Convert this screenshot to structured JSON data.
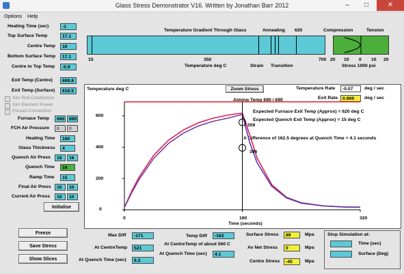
{
  "window": {
    "title": "Glass Stress Demonstrator V16. Written by Jonathan Barr 2012",
    "btn_min": "–",
    "btn_max": "□",
    "btn_close": "✕"
  },
  "menu": {
    "options": "Options",
    "help": "Help"
  },
  "left_top": {
    "heating_time_label": "Heating Time (sec)",
    "heating_time_value": "-1",
    "top_surface_label": "Top Surface Temp",
    "top_surface_value": "17.1",
    "centre_label": "Centre Temp",
    "centre_value": "16",
    "bottom_surface_label": "Bottom Surface Temp",
    "bottom_surface_value": "17.1",
    "centre_to_top_label": "Centre to Top Temp",
    "centre_to_top_value": "-0.9",
    "exit_centre_label": "Exit Temp  (Centre)",
    "exit_centre_value": "608.8",
    "exit_surface_label": "Exit Temp (Surface)",
    "exit_surface_value": "618.5"
  },
  "checkboxes": {
    "roll": "Sim Roll Conduction",
    "element": "Sim Element Power",
    "convection": "Forced Convection"
  },
  "params": {
    "furnace_label": "Furnace Temp",
    "furnace_a": "690",
    "furnace_b": "690",
    "fch_label": "FCH Air Pressure",
    "fch_a": "0",
    "fch_b": "0",
    "heating_label": "Heating Time",
    "heating_value": "160",
    "thickness_label": "Glass Thickness",
    "thickness_value": "4",
    "quench_press_label": "Quench Air Press",
    "quench_press_a": "16",
    "quench_press_b": "16",
    "quench_time_label": "Quench Time",
    "quench_time_value": "16",
    "ramp_label": "Ramp Time",
    "ramp_value": "15",
    "final_label": "Final Air Press",
    "final_a": "10",
    "final_b": "10",
    "current_label": "Current Air Press",
    "current_a": "10",
    "current_b": "10",
    "initialise": "Initialise"
  },
  "buttons": {
    "freeze": "Freeze",
    "save": "Save Stress",
    "slices": "Show Slices"
  },
  "gradient": {
    "heading": "Temperature Gradient Through Glass",
    "annealing": "Annealing",
    "t620": "620",
    "compression": "Compression",
    "tension": "Tension",
    "x15": "15",
    "x350": "350",
    "x700": "700",
    "axis_label": "Temperature deg C",
    "strain": "Strain",
    "transition": "Transition",
    "s20a": "20",
    "s10a": "10",
    "s0": "0",
    "s10b": "10",
    "s20b": "20",
    "stress_label": "Stress 1000 psi"
  },
  "chart_panel": {
    "temp_label": "Temperature deg C",
    "zoom_button": "Zoom Stress",
    "temp_rate_label": "Temperature Rate",
    "temp_rate_value": "-0.07",
    "temp_rate_unit": "deg / sec",
    "aiming": "Aiming Temp  690 / 690",
    "exit_rate_label": "Exit Rate",
    "exit_rate_value": "0.969",
    "exit_rate_unit": "deg / sec",
    "expected_furnace": "Expected Furnace Exit Temp (Approx) =  620  deg C",
    "expected_quench": "Expected Quench Exit Temp (Approx) =  15  deg C",
    "difference": "A Difference of 162.5 degrees at Quench Time = 4.1 seconds",
    "y600": "600",
    "y400": "400",
    "y200": "200",
    "y0": "0",
    "x0": "0",
    "x160": "160",
    "x320": "320",
    "x_label": "Time (seconds)",
    "marker_559": "559",
    "marker_396": "396"
  },
  "chart_data": {
    "type": "line",
    "xlabel": "Time (seconds)",
    "ylabel": "Temperature deg C",
    "xlim": [
      0,
      320
    ],
    "ylim": [
      0,
      690
    ],
    "grid": false,
    "series": [
      {
        "x": [
          0,
          320
        ],
        "y": [
          690,
          690
        ],
        "color": "#e02020"
      },
      {
        "x": [
          0,
          10,
          20,
          40,
          60,
          80,
          100,
          120,
          140,
          160
        ],
        "y": [
          15,
          120,
          210,
          350,
          445,
          510,
          555,
          585,
          605,
          618
        ],
        "color": "#d42050"
      },
      {
        "x": [
          0,
          10,
          20,
          40,
          60,
          80,
          100,
          120,
          140,
          160
        ],
        "y": [
          15,
          110,
          195,
          330,
          425,
          490,
          535,
          565,
          585,
          609
        ],
        "color": "#7a3aa0"
      },
      {
        "x": [
          160,
          170,
          180,
          200,
          220,
          240,
          270,
          300,
          320
        ],
        "y": [
          618,
          480,
          330,
          160,
          80,
          45,
          25,
          18,
          17
        ],
        "color": "#d42050"
      },
      {
        "x": [
          160,
          170,
          180,
          200,
          220,
          240,
          270,
          300,
          320
        ],
        "y": [
          609,
          430,
          300,
          150,
          75,
          42,
          24,
          17,
          16
        ],
        "color": "#5a3ab0"
      }
    ],
    "annotations": [
      {
        "x": 160,
        "y": 559,
        "label": "559"
      },
      {
        "x": 160,
        "y": 396,
        "label": "396"
      }
    ]
  },
  "bottom": {
    "max_diff_label": "Max Diff",
    "max_diff_value": "-171",
    "at_centre_label": "At CentreTemp",
    "at_centre_value": "521",
    "at_quench_label": "At Quench Time (sec)",
    "at_quench_value": "6.2",
    "temp_diff_label": "Temp Diff",
    "temp_diff_value": "-162",
    "about_label": "At CentreTemp of about 560 C",
    "at_quench2_label": "At Quench Time (sec)",
    "at_quench2_value": "4.1",
    "surface_label": "Surface Stress",
    "surface_value": "89",
    "surface_unit": "Mpa",
    "avnet_label": "Av Net Stress",
    "avnet_value": "0",
    "avnet_unit": "Mpa",
    "centre_stress_label": "Centre Stress",
    "centre_stress_value": "-45",
    "centre_stress_unit": "Mpa",
    "stop_label": "Stop Simulation at:",
    "stop_time": "Time (sec)",
    "stop_surface": "Surface (Deg)"
  }
}
